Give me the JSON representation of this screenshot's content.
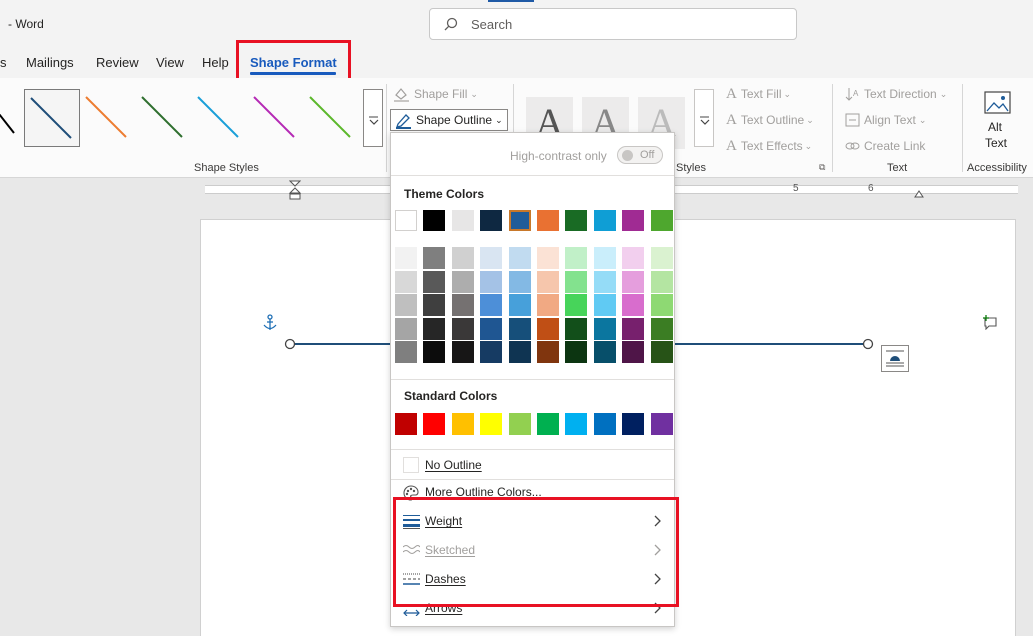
{
  "window": {
    "title": "- Word"
  },
  "search": {
    "placeholder": "Search"
  },
  "tabs": [
    {
      "label": "s"
    },
    {
      "label": "Mailings"
    },
    {
      "label": "Review"
    },
    {
      "label": "View"
    },
    {
      "label": "Help"
    },
    {
      "label": "Shape Format",
      "active": true
    }
  ],
  "ribbon": {
    "shape_styles": {
      "label": "Shape Styles",
      "swatches": [
        "#000000",
        "#1f4e79",
        "#ed7d31",
        "#2f6f2f",
        "#1a9fd8",
        "#b52ab5",
        "#5cb82c"
      ]
    },
    "shape_fill": "Shape Fill",
    "shape_outline": "Shape Outline",
    "wordart_label": "Styles",
    "wordart_letter": "A",
    "text_fill": "Text Fill",
    "text_outline": "Text Outline",
    "text_effects": "Text Effects",
    "text_direction": "Text Direction",
    "align_text": "Align Text",
    "create_link": "Create Link",
    "text_group_label": "Text",
    "alt_text_line1": "Alt",
    "alt_text_line2": "Text",
    "accessibility_label": "Accessibility"
  },
  "ruler": {
    "numbers": [
      "5",
      "6"
    ]
  },
  "dropdown": {
    "high_contrast_label": "High-contrast only",
    "toggle_state": "Off",
    "theme_colors_header": "Theme Colors",
    "theme_colors": [
      "#ffffff",
      "#000000",
      "#e7e6e6",
      "#0e2841",
      "#1f5c99",
      "#e97132",
      "#196b24",
      "#0f9ed5",
      "#a02b93",
      "#4ea72e"
    ],
    "theme_shades": [
      [
        "#f2f2f2",
        "#7f7f7f",
        "#d0d0d0",
        "#d9e5f2",
        "#c1dbf0",
        "#fbe2d5",
        "#c1f0c8",
        "#caeefb",
        "#f2cfee",
        "#daf2d0"
      ],
      [
        "#d8d8d8",
        "#595959",
        "#adadad",
        "#a4c2e6",
        "#83b9e4",
        "#f6c6ac",
        "#83e28e",
        "#95dcf7",
        "#e59edd",
        "#b4e5a2"
      ],
      [
        "#bfbfbf",
        "#3f3f3f",
        "#757171",
        "#4d8fd8",
        "#47a0da",
        "#f1a983",
        "#47d45a",
        "#60caf3",
        "#d86dcd",
        "#8ed973"
      ],
      [
        "#a5a5a5",
        "#262626",
        "#3a3838",
        "#1f5692",
        "#164f7a",
        "#c04f15",
        "#124f1a",
        "#0b769f",
        "#77206d",
        "#3b7d23"
      ],
      [
        "#7f7f7f",
        "#0c0c0c",
        "#171616",
        "#163b63",
        "#0f3452",
        "#80350e",
        "#0c3511",
        "#074f6a",
        "#4f1548",
        "#275317"
      ]
    ],
    "standard_colors_header": "Standard Colors",
    "standard_colors": [
      "#c00000",
      "#ff0000",
      "#ffc000",
      "#ffff00",
      "#92d050",
      "#00b050",
      "#00b0f0",
      "#0070c0",
      "#002060",
      "#7030a0"
    ],
    "no_outline": "No Outline",
    "more_outline_colors": "More Outline Colors...",
    "weight": "Weight",
    "sketched": "Sketched",
    "dashes": "Dashes",
    "arrows": "Arrows"
  }
}
